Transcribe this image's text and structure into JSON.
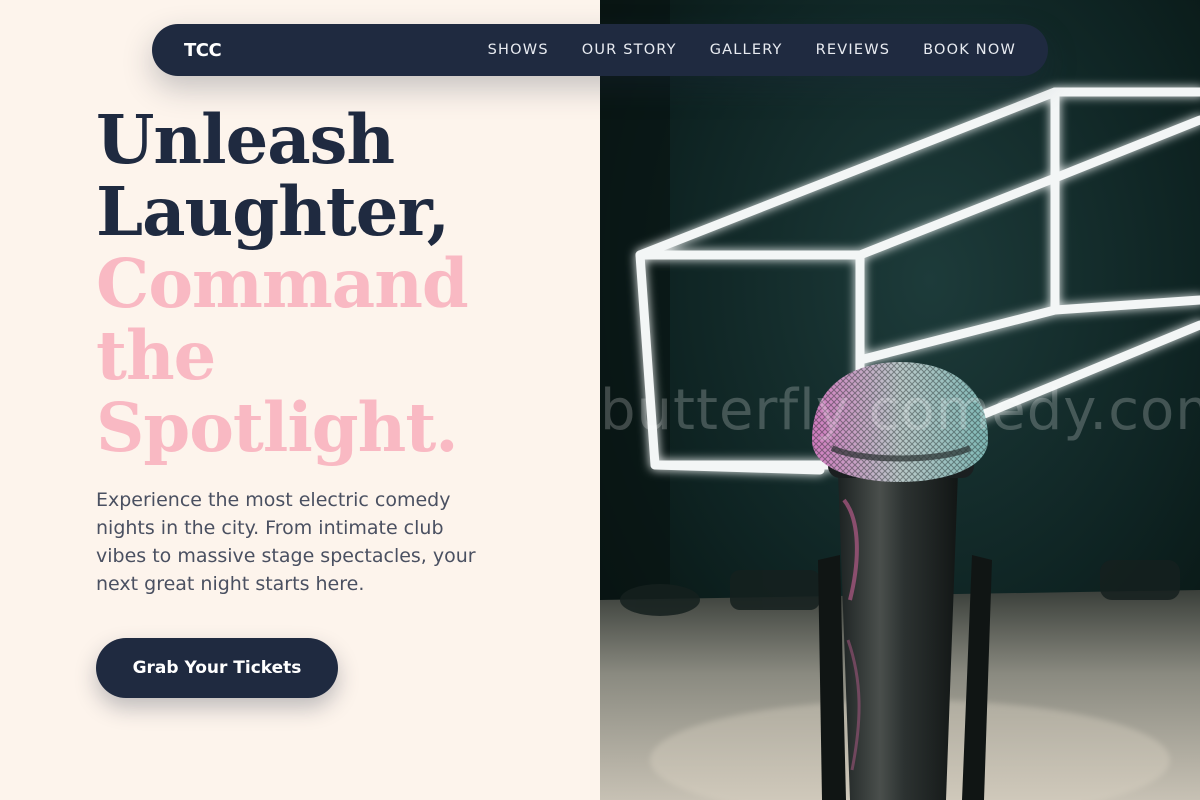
{
  "nav": {
    "brand": "TCC",
    "links": [
      "SHOWS",
      "OUR STORY",
      "GALLERY",
      "REVIEWS",
      "BOOK NOW"
    ]
  },
  "hero": {
    "heading_dark": [
      "Unleash",
      "Laughter,"
    ],
    "heading_accent": [
      "Command",
      "the",
      "Spotlight."
    ],
    "description": "Experience the most electric comedy nights in the city. From intimate club vibes to massive stage spectacles, your next great night starts here.",
    "cta_label": "Grab Your Tickets"
  },
  "photo": {
    "subject": "microphone-on-stage",
    "watermark": "butterfly comedy.com"
  },
  "colors": {
    "navy": "#1f2a40",
    "pink": "#f9b9c3",
    "cream": "#fdf4ec",
    "body_text": "#4a5061"
  }
}
